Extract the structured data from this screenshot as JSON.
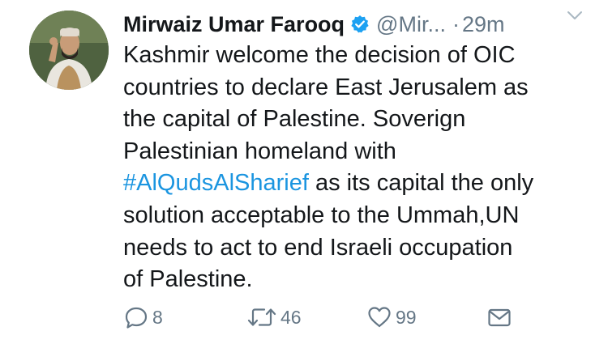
{
  "author": {
    "name": "Mirwaiz Umar Farooq",
    "handle": "@Mir...",
    "separator": "·",
    "time": "29m"
  },
  "tweet": {
    "lines": [
      "Kashmir welcome the decision of OIC",
      "countries to declare East Jerusalem as",
      "the capital of Palestine. Soverign",
      "Palestinian homeland with",
      "",
      "solution acceptable  to the Ummah,UN",
      "needs to act to end Israeli occupation",
      "of Palestine."
    ],
    "hashtag": "#AlQudsAlSharief",
    "line5_rest": " as its capital the only"
  },
  "actions": {
    "reply_count": "8",
    "retweet_count": "46",
    "like_count": "99"
  },
  "icons": {
    "verified": "verified-badge-icon",
    "more": "chevron-down-icon",
    "reply": "reply-icon",
    "retweet": "retweet-icon",
    "like": "heart-icon",
    "dm": "envelope-icon"
  },
  "colors": {
    "link": "#1b95e0",
    "muted": "#657786",
    "text": "#14171a"
  }
}
